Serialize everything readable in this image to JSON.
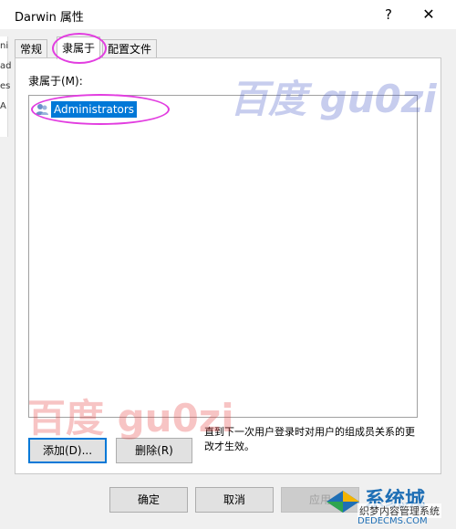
{
  "window": {
    "title": "Darwin 属性",
    "help": "?",
    "close": "✕"
  },
  "background": {
    "fragments": [
      "ni",
      "ad",
      "es",
      "A"
    ]
  },
  "tabs": [
    {
      "label": "常规",
      "active": false
    },
    {
      "label": "隶属于",
      "active": true
    },
    {
      "label": "配置文件",
      "active": false
    }
  ],
  "panel": {
    "label": "隶属于(M):",
    "items": [
      {
        "name": "Administrators",
        "icon": "group-icon",
        "selected": true
      }
    ],
    "add_label": "添加(D)...",
    "remove_label": "删除(R)",
    "note": "直到下一次用户登录时对用户的组成员关系的更改才生效。"
  },
  "footer": {
    "ok": "确定",
    "cancel": "取消",
    "apply": "应用"
  },
  "watermarks": {
    "top": "百度 gu0zi",
    "bottom": "百度 gu0zi"
  },
  "site_logo": {
    "name": "系统城",
    "subtitle": "织梦内容管理系统",
    "url": "DEDECMS.COM"
  },
  "colors": {
    "selection": "#0078d7",
    "highlight": "#e23de0"
  }
}
